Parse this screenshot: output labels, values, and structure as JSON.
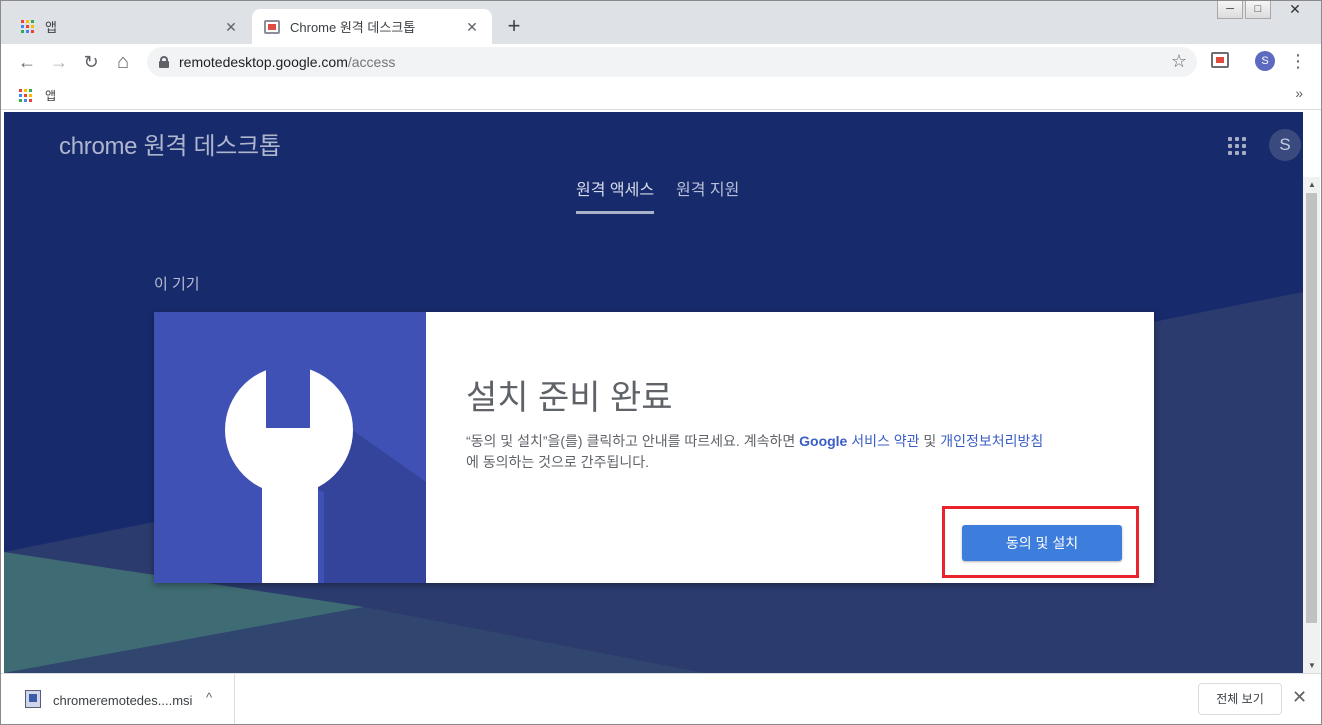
{
  "window": {
    "minimize_label": "─",
    "maximize_label": "□",
    "close_label": "✕"
  },
  "tabs": [
    {
      "title": "앱",
      "icon": "apps-grid-icon",
      "close": "✕"
    },
    {
      "title": "Chrome 원격 데스크톱",
      "icon": "remote-desktop-icon",
      "close": "✕"
    }
  ],
  "new_tab_label": "+",
  "toolbar": {
    "back": "←",
    "forward": "→",
    "reload": "↻",
    "home": "⌂",
    "url_host": "remotedesktop.google.com",
    "url_path": "/access",
    "bookmark_star": "☆",
    "profile_initial": "S",
    "menu": "⋮"
  },
  "bookmarks": {
    "apps_label": "앱",
    "overflow": "»"
  },
  "page": {
    "brand": "chrome 원격 데스크톱",
    "avatar_initial": "S",
    "nav_tabs": [
      {
        "label": "원격 액세스",
        "active": true
      },
      {
        "label": "원격 지원",
        "active": false
      }
    ],
    "section_label": "이 기기",
    "card": {
      "title": "설치 준비 완료",
      "desc_part1": "“동의 및 설치”을(를) 클릭하고 안내를 따르세요. 계속하면 ",
      "google": "Google",
      "terms_link": " 서비스 약관",
      "desc_and": " 및 ",
      "privacy_link": "개인정보처리방침",
      "desc_part2": "에 동의하는 것으로 간주됩니다.",
      "button_label": "동의 및 설치"
    }
  },
  "scrollbar": {
    "up": "▲",
    "down": "▼"
  },
  "download": {
    "filename": "chromeremotedes....msi",
    "chevron": "^",
    "show_all": "전체 보기",
    "close": "✕"
  },
  "colors": {
    "page_bg": "#172a6b",
    "illustration_bg": "#3f51b5",
    "button": "#3d7ddc",
    "highlight": "#e8232c"
  }
}
